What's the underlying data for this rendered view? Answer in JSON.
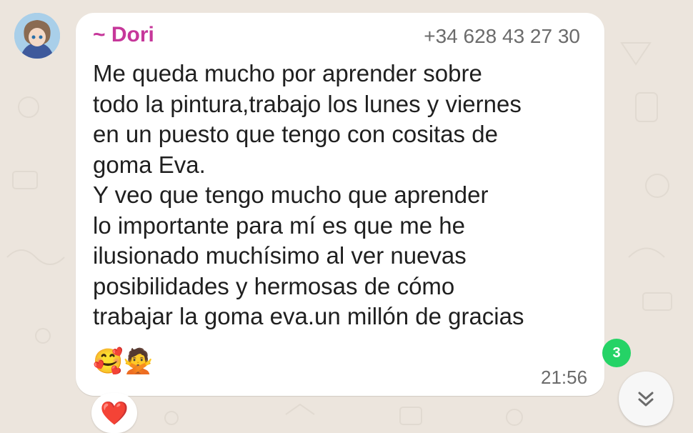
{
  "message": {
    "sender": "~ Dori",
    "phone": "+34 628 43 27 30",
    "text": "Me queda mucho por aprender sobre\ntodo la pintura,trabajo los lunes y viernes\nen un puesto que tengo con cositas de\ngoma Eva.\nY veo que tengo mucho que aprender\nlo importante para mí es que me he\nilusionado muchísimo al ver nuevas\nposibilidades y hermosas de cómo\ntrabajar la goma eva.un millón de gracias",
    "emojis": "🥰🙅",
    "time": "21:56",
    "reaction": "❤️"
  },
  "unread_count": "3",
  "icons": {
    "avatar": "avatar-anime-girl",
    "scroll_down": "double-chevron-down-icon"
  },
  "colors": {
    "sender": "#c6379a",
    "badge": "#25d366",
    "background": "#ece5dd"
  }
}
